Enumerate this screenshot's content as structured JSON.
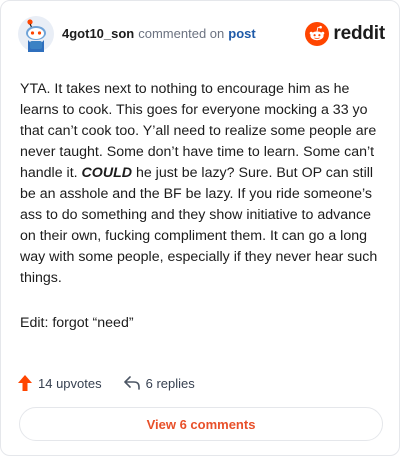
{
  "header": {
    "username": "4got10_son",
    "action_text": "commented on",
    "post_link": "post",
    "brand_name": "reddit"
  },
  "comment": {
    "body_before_emphasis": "YTA. It takes next to nothing to encourage him as he learns to cook. This goes for everyone mocking a 33 yo that can’t cook too. Y’all need to realize some people are never taught. Some don’t have time to learn. Some can’t handle it.",
    "emphasis": "COULD",
    "body_after_emphasis": "he just be lazy? Sure. But OP can still be an asshole and the BF be lazy. If you ride someone’s ass to do something and they show initiative to advance on their own, fucking compliment them. It can go a long way with some people, especially if they never hear such things.",
    "edit": "Edit: forgot “need”"
  },
  "stats": {
    "upvotes": "14 upvotes",
    "replies": "6 replies"
  },
  "footer": {
    "view_comments": "View 6 comments"
  },
  "colors": {
    "brand_orange": "#ff4500",
    "upvote_orange": "#ff4500",
    "link_blue": "#1e5aa8",
    "button_text": "#e8502a"
  },
  "icons": {
    "avatar": "snoo-avatar-icon",
    "brand": "reddit-logo-icon",
    "upvote": "upvote-arrow-icon",
    "reply": "reply-arrow-icon"
  }
}
